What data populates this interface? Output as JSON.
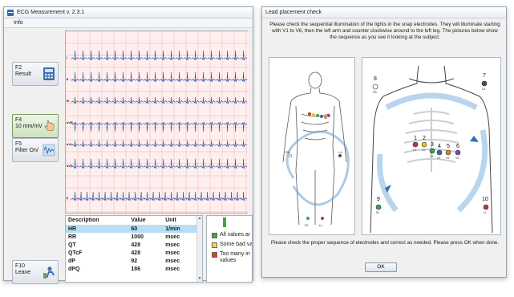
{
  "left_window": {
    "title": "ECG Measurement v. 2.3.1",
    "menu": [
      "Info"
    ],
    "fkeys": [
      {
        "key": "F2",
        "label": "Result",
        "icon": "calculator-icon"
      },
      {
        "key": "F4",
        "label": "10 mm/mV",
        "icon": "hand-pointer-icon"
      },
      {
        "key": "F5",
        "label": "Filter On/",
        "icon": "filter-icon"
      },
      {
        "key": "F10",
        "label": "Leave",
        "icon": "exit-icon"
      }
    ],
    "leads": [
      "I",
      "II",
      "III",
      "aVR",
      "aVL",
      "aVF",
      "II"
    ],
    "table": {
      "headers": [
        "Description",
        "Value",
        "Unit"
      ],
      "rows": [
        {
          "desc": "HR",
          "value": "60",
          "unit": "1/min"
        },
        {
          "desc": "RR",
          "value": "1000",
          "unit": "msec"
        },
        {
          "desc": "QT",
          "value": "428",
          "unit": "msec"
        },
        {
          "desc": "QTcF",
          "value": "428",
          "unit": "msec"
        },
        {
          "desc": "dP",
          "value": "92",
          "unit": "msec"
        },
        {
          "desc": "dPQ",
          "value": "186",
          "unit": "msec"
        }
      ]
    },
    "legend": [
      {
        "color": "#3fa63a",
        "text": "All values ar"
      },
      {
        "color": "#f2d64b",
        "text": "Some bad va"
      },
      {
        "color": "#e23c2e",
        "text": "Too many in values"
      }
    ]
  },
  "right_window": {
    "title": "Lead placement check",
    "instructions": "Please check the sequential illumination of the lights in the snap electrodes. They will illuminate starting with V1 to V6, then the left arm and counter clockwise around to the left leg. The pictures below show the sequence as you see it looking at the subject.",
    "footer": "Please check the proper sequence of electrodes and correct as needed. Please press OK when done.",
    "ok_label": "OK",
    "electrodes": [
      {
        "num": "1",
        "tag": "V1",
        "color": "#c0392b"
      },
      {
        "num": "2",
        "tag": "V2",
        "color": "#f1c40f"
      },
      {
        "num": "3",
        "tag": "V3",
        "color": "#3aa64a"
      },
      {
        "num": "4",
        "tag": "V4",
        "color": "#2f6fb7"
      },
      {
        "num": "5",
        "tag": "V5",
        "color": "#e67e22"
      },
      {
        "num": "6",
        "tag": "V6",
        "color": "#8e44ad"
      },
      {
        "num": "7",
        "tag": "LA",
        "color": "#4d4d4d"
      },
      {
        "num": "8",
        "tag": "RA",
        "color": "#ffffff"
      },
      {
        "num": "9",
        "tag": "RL",
        "color": "#3aa64a"
      },
      {
        "num": "10",
        "tag": "LL",
        "color": "#c0392b"
      }
    ],
    "small_labels": [
      "RA",
      "LA",
      "RL",
      "LL"
    ]
  }
}
